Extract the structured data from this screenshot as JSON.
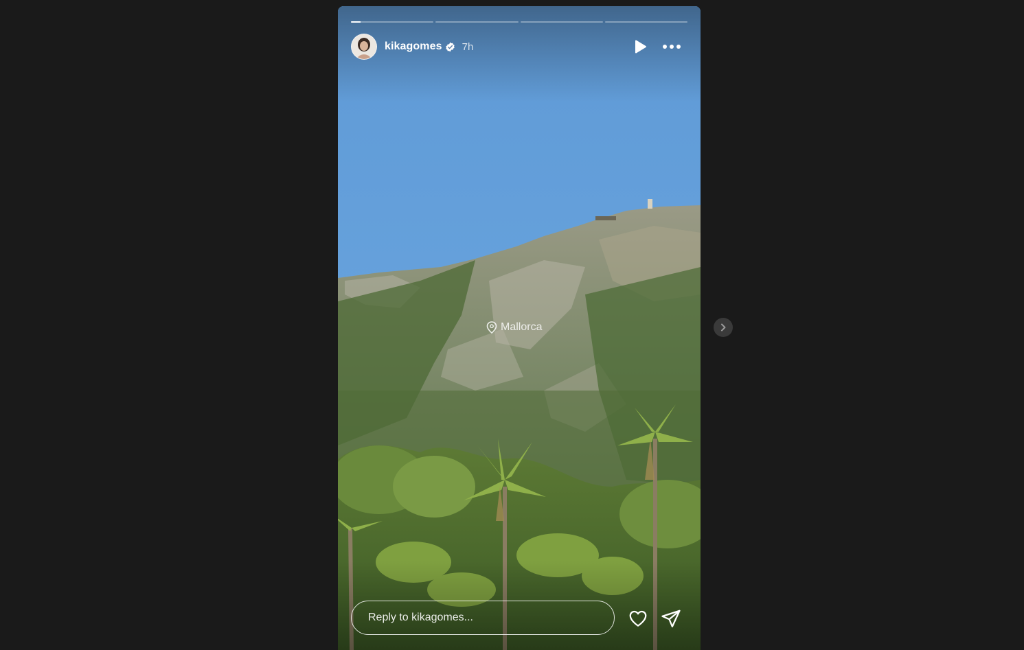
{
  "story": {
    "username": "kikagomes",
    "verified": true,
    "time_ago": "7h",
    "progress": {
      "segments": 4,
      "current_index": 0,
      "current_fill_fraction": 0.12
    },
    "location": "Mallorca",
    "reply": {
      "placeholder": "Reply to kikagomes..."
    }
  },
  "icons": {
    "play": "play-icon",
    "more": "more-horizontal-icon",
    "location": "location-pin-icon",
    "like": "heart-icon",
    "share": "paper-plane-icon",
    "verified": "verified-badge-icon",
    "next": "chevron-right-icon"
  },
  "colors": {
    "page_background": "#1a1a1a",
    "sky": "#6aa6de",
    "verified_badge": "#ffffff",
    "next_button": "#3a3a3a"
  }
}
